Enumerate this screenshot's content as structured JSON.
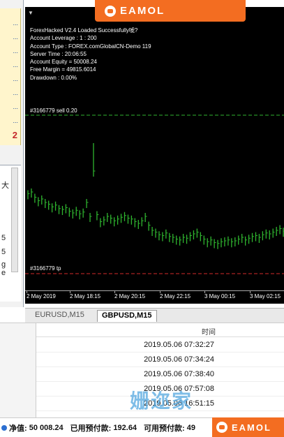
{
  "logo": {
    "text": "EAMOL"
  },
  "left_panel": {
    "dots": [
      "...",
      "...",
      "...",
      "...",
      "...",
      "...",
      "...",
      "..."
    ],
    "number": "2",
    "chars": [
      "大",
      "5",
      "5",
      "g",
      "e"
    ]
  },
  "chart": {
    "info_lines": [
      "ForexHacked V2.4 Loaded Successfully唬?",
      "Account Leverage  :  1 : 200",
      "Account Type  :  FOREX.comGlobalCN-Demo 119",
      "Server Time  :  20:06:55",
      "Account Equity  =  50008.24",
      "Free Margin  =  49815.6014",
      "Drawdown  :  0.00%"
    ],
    "sell_label": "#3166779 sell 0.20",
    "tp_label": "#3166779 tp",
    "time_ticks": [
      "2 May 2019",
      "2 May 18:15",
      "2 May 20:15",
      "2 May 22:15",
      "3 May 00:15",
      "3 May 02:15"
    ],
    "colors": {
      "bars": "#2fb52f",
      "sell_line": "#2fb52f",
      "tp_line": "#d42a2a",
      "background": "#000000"
    }
  },
  "chart_data": {
    "type": "bar",
    "title": "",
    "xlabel": "",
    "ylabel": "",
    "categories": [
      "2 May 2019",
      "2 May 18:15",
      "2 May 20:15",
      "2 May 22:15",
      "3 May 00:15",
      "3 May 02:15"
    ],
    "series": [
      {
        "values": [
          0.62,
          0.64,
          0.58,
          0.54,
          0.56,
          0.52,
          0.5,
          0.47,
          0.49,
          0.45,
          0.44,
          0.46,
          0.42,
          0.4,
          0.43,
          0.39,
          0.41,
          0.52,
          0.36,
          0.88,
          0.38,
          0.3,
          0.32,
          0.36,
          0.34,
          0.31,
          0.33,
          0.35,
          0.37,
          0.34,
          0.33,
          0.3,
          0.28,
          0.31,
          0.36,
          0.26,
          0.2,
          0.18,
          0.15,
          0.14,
          0.17,
          0.13,
          0.12,
          0.1,
          0.09,
          0.12,
          0.11,
          0.14,
          0.16,
          0.18,
          0.14,
          0.1,
          0.07,
          0.09,
          0.06,
          0.05,
          0.07,
          0.08,
          0.09,
          0.07,
          0.08,
          0.1,
          0.12,
          0.09,
          0.11,
          0.13,
          0.14,
          0.12,
          0.15,
          0.17,
          0.16,
          0.18,
          0.2,
          0.22,
          0.19
        ]
      }
    ]
  },
  "tabs": [
    "EURUSD,M15",
    "GBPUSD,M15"
  ],
  "table": {
    "header": "时间",
    "rows": [
      "2019.05.06 07:32:27",
      "2019.05.06 07:34:24",
      "2019.05.06 07:38:40",
      "2019.05.06 07:57:08",
      "2019.05.06 16:51:15"
    ]
  },
  "status": {
    "equity_label": "净值:",
    "equity_value": "50 008.24",
    "margin_label": "已用预付款:",
    "margin_value": "192.64",
    "free_label": "可用预付款:",
    "free_value": "49"
  },
  "watermark": "姗迩家"
}
